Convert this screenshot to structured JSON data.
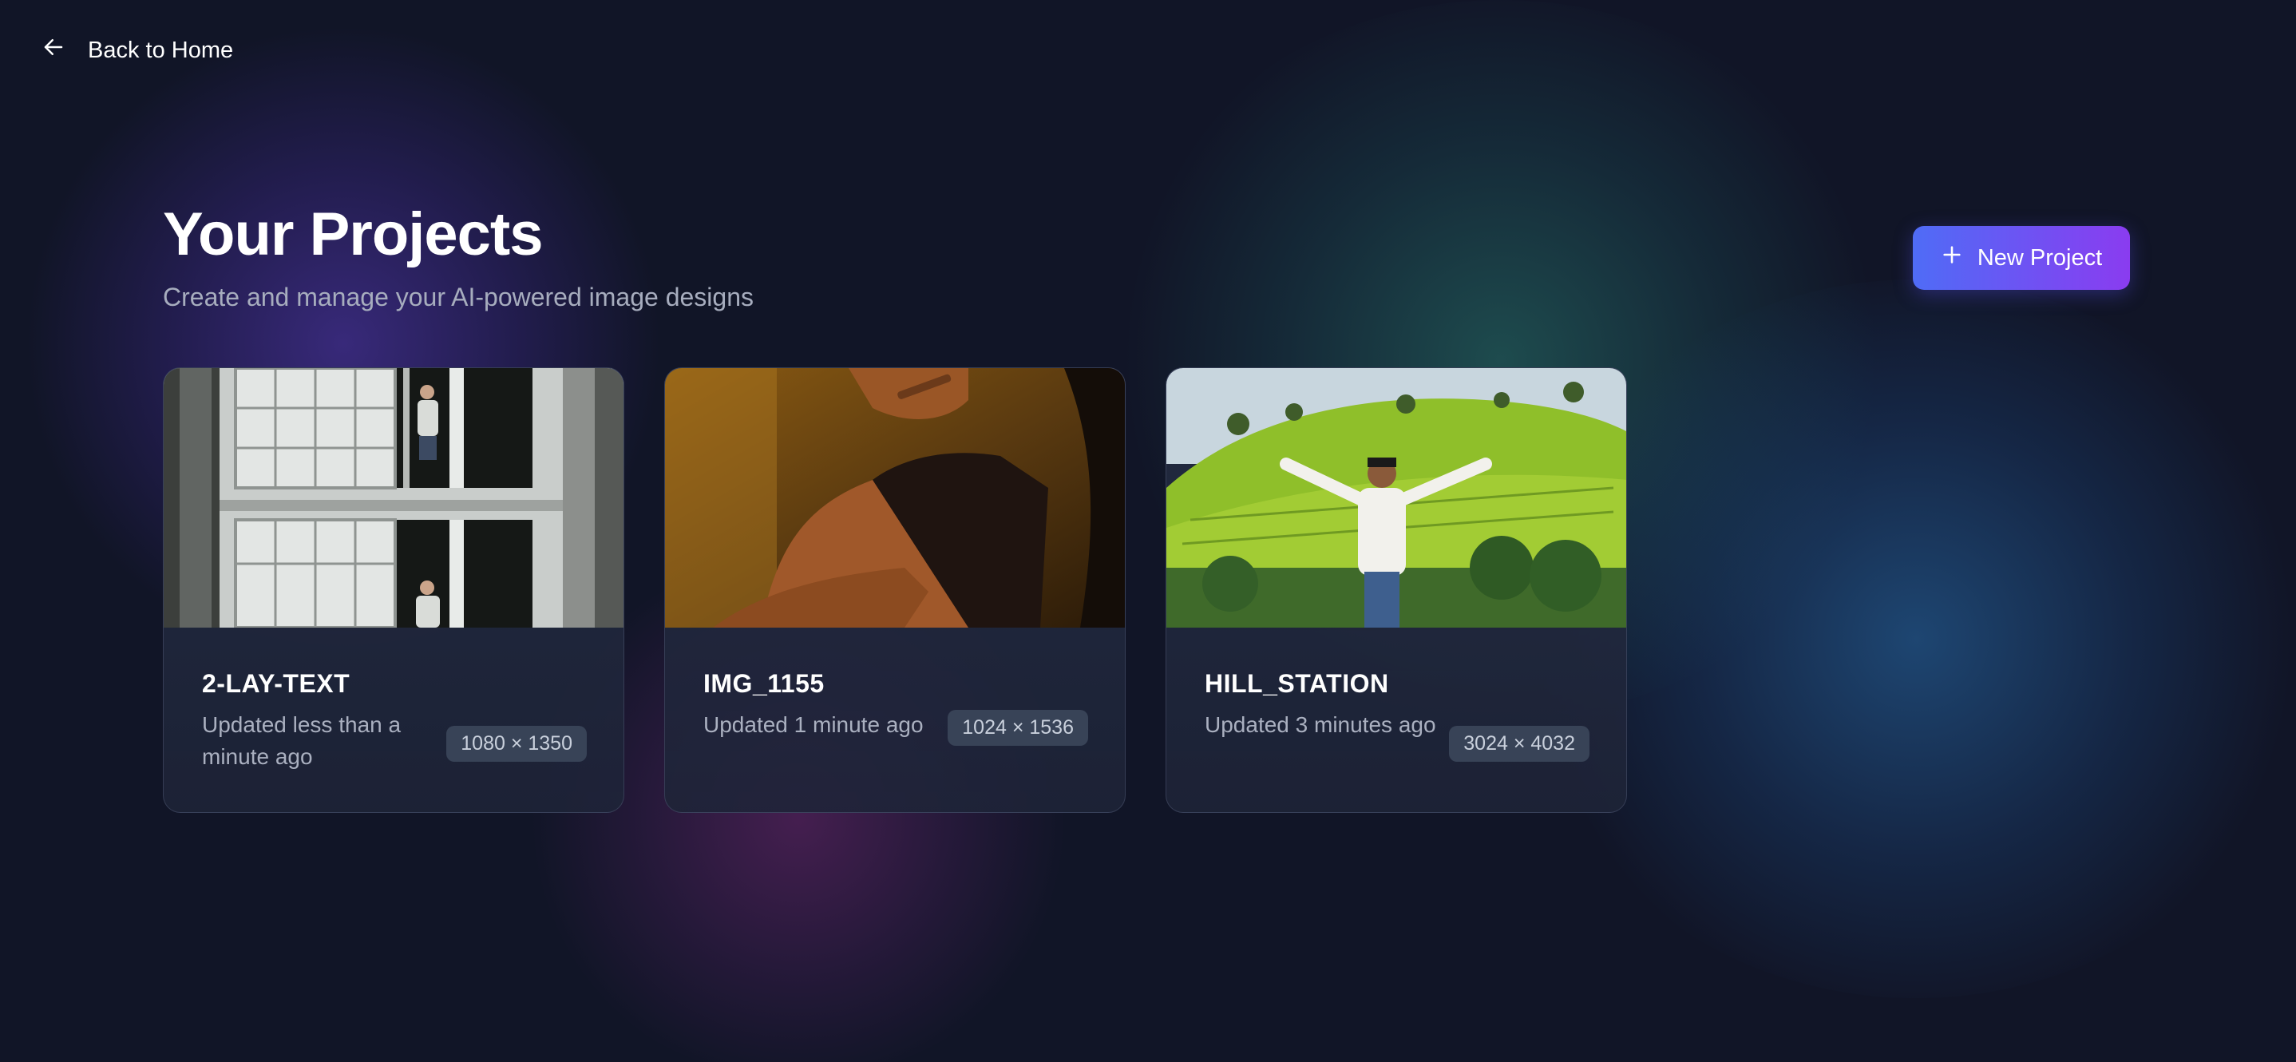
{
  "nav": {
    "back_label": "Back to Home",
    "back_icon": "arrow-left-icon"
  },
  "header": {
    "title": "Your Projects",
    "subtitle": "Create and manage your AI-powered image designs",
    "new_project_label": "New Project",
    "new_project_icon": "plus-icon"
  },
  "colors": {
    "background": "#111527",
    "button_gradient_start": "#4f6cf6",
    "button_gradient_end": "#8a3cf0",
    "badge_bg": "#384357"
  },
  "projects": [
    {
      "name": "2-LAY-TEXT",
      "updated": "Updated less than a minute ago",
      "dimensions": "1080 × 1350"
    },
    {
      "name": "IMG_1155",
      "updated": "Updated 1 minute ago",
      "dimensions": "1024 × 1536"
    },
    {
      "name": "HILL_STATION",
      "updated": "Updated 3 minutes ago",
      "dimensions": "3024 × 4032"
    }
  ]
}
